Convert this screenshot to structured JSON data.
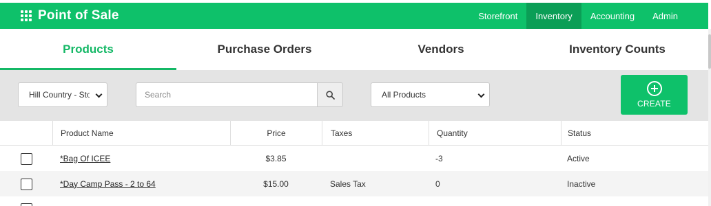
{
  "app": {
    "title": "Point of Sale",
    "logo_icon": "grid-icon"
  },
  "topnav": {
    "items": [
      {
        "label": "Storefront",
        "active": false
      },
      {
        "label": "Inventory",
        "active": true
      },
      {
        "label": "Accounting",
        "active": false
      },
      {
        "label": "Admin",
        "active": false
      }
    ]
  },
  "tabs": [
    {
      "label": "Products",
      "active": true
    },
    {
      "label": "Purchase Orders",
      "active": false
    },
    {
      "label": "Vendors",
      "active": false
    },
    {
      "label": "Inventory Counts",
      "active": false
    }
  ],
  "filters": {
    "store_select": "Hill Country - Store",
    "search_placeholder": "Search",
    "search_value": "",
    "product_filter": "All Products",
    "create_label": "CREATE"
  },
  "table": {
    "columns": [
      "Product Name",
      "Price",
      "Taxes",
      "Quantity",
      "Status"
    ],
    "rows": [
      {
        "name": "*Bag Of ICEE",
        "price": "$3.85",
        "taxes": "",
        "quantity": "-3",
        "status": "Active"
      },
      {
        "name": "*Day Camp Pass - 2 to 64",
        "price": "$15.00",
        "taxes": "Sales Tax",
        "quantity": "0",
        "status": "Inactive"
      }
    ]
  },
  "colors": {
    "brand": "#0ec16a",
    "brand_dark": "#0b9e56",
    "active_tab": "#14b866"
  }
}
